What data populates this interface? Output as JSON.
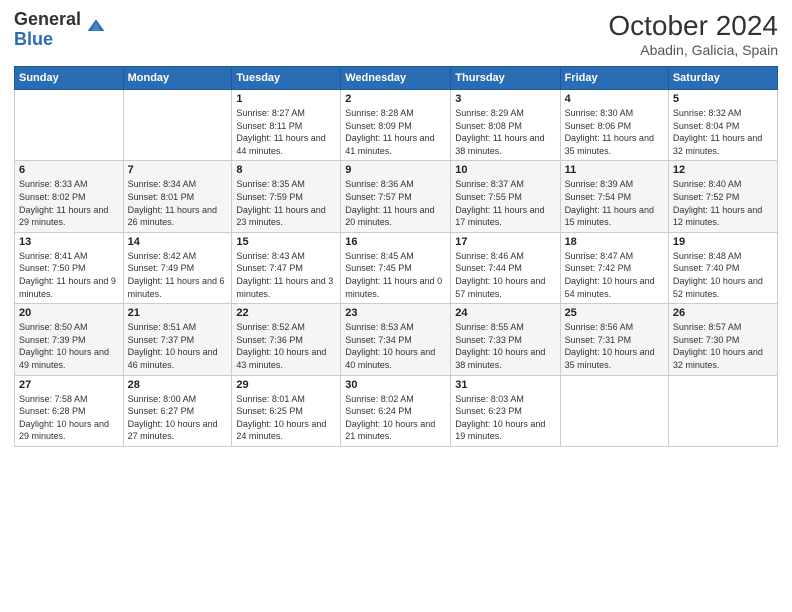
{
  "logo": {
    "general": "General",
    "blue": "Blue"
  },
  "title": "October 2024",
  "location": "Abadin, Galicia, Spain",
  "days_of_week": [
    "Sunday",
    "Monday",
    "Tuesday",
    "Wednesday",
    "Thursday",
    "Friday",
    "Saturday"
  ],
  "weeks": [
    [
      {
        "day": "",
        "sunrise": "",
        "sunset": "",
        "daylight": ""
      },
      {
        "day": "",
        "sunrise": "",
        "sunset": "",
        "daylight": ""
      },
      {
        "day": "1",
        "sunrise": "Sunrise: 8:27 AM",
        "sunset": "Sunset: 8:11 PM",
        "daylight": "Daylight: 11 hours and 44 minutes."
      },
      {
        "day": "2",
        "sunrise": "Sunrise: 8:28 AM",
        "sunset": "Sunset: 8:09 PM",
        "daylight": "Daylight: 11 hours and 41 minutes."
      },
      {
        "day": "3",
        "sunrise": "Sunrise: 8:29 AM",
        "sunset": "Sunset: 8:08 PM",
        "daylight": "Daylight: 11 hours and 38 minutes."
      },
      {
        "day": "4",
        "sunrise": "Sunrise: 8:30 AM",
        "sunset": "Sunset: 8:06 PM",
        "daylight": "Daylight: 11 hours and 35 minutes."
      },
      {
        "day": "5",
        "sunrise": "Sunrise: 8:32 AM",
        "sunset": "Sunset: 8:04 PM",
        "daylight": "Daylight: 11 hours and 32 minutes."
      }
    ],
    [
      {
        "day": "6",
        "sunrise": "Sunrise: 8:33 AM",
        "sunset": "Sunset: 8:02 PM",
        "daylight": "Daylight: 11 hours and 29 minutes."
      },
      {
        "day": "7",
        "sunrise": "Sunrise: 8:34 AM",
        "sunset": "Sunset: 8:01 PM",
        "daylight": "Daylight: 11 hours and 26 minutes."
      },
      {
        "day": "8",
        "sunrise": "Sunrise: 8:35 AM",
        "sunset": "Sunset: 7:59 PM",
        "daylight": "Daylight: 11 hours and 23 minutes."
      },
      {
        "day": "9",
        "sunrise": "Sunrise: 8:36 AM",
        "sunset": "Sunset: 7:57 PM",
        "daylight": "Daylight: 11 hours and 20 minutes."
      },
      {
        "day": "10",
        "sunrise": "Sunrise: 8:37 AM",
        "sunset": "Sunset: 7:55 PM",
        "daylight": "Daylight: 11 hours and 17 minutes."
      },
      {
        "day": "11",
        "sunrise": "Sunrise: 8:39 AM",
        "sunset": "Sunset: 7:54 PM",
        "daylight": "Daylight: 11 hours and 15 minutes."
      },
      {
        "day": "12",
        "sunrise": "Sunrise: 8:40 AM",
        "sunset": "Sunset: 7:52 PM",
        "daylight": "Daylight: 11 hours and 12 minutes."
      }
    ],
    [
      {
        "day": "13",
        "sunrise": "Sunrise: 8:41 AM",
        "sunset": "Sunset: 7:50 PM",
        "daylight": "Daylight: 11 hours and 9 minutes."
      },
      {
        "day": "14",
        "sunrise": "Sunrise: 8:42 AM",
        "sunset": "Sunset: 7:49 PM",
        "daylight": "Daylight: 11 hours and 6 minutes."
      },
      {
        "day": "15",
        "sunrise": "Sunrise: 8:43 AM",
        "sunset": "Sunset: 7:47 PM",
        "daylight": "Daylight: 11 hours and 3 minutes."
      },
      {
        "day": "16",
        "sunrise": "Sunrise: 8:45 AM",
        "sunset": "Sunset: 7:45 PM",
        "daylight": "Daylight: 11 hours and 0 minutes."
      },
      {
        "day": "17",
        "sunrise": "Sunrise: 8:46 AM",
        "sunset": "Sunset: 7:44 PM",
        "daylight": "Daylight: 10 hours and 57 minutes."
      },
      {
        "day": "18",
        "sunrise": "Sunrise: 8:47 AM",
        "sunset": "Sunset: 7:42 PM",
        "daylight": "Daylight: 10 hours and 54 minutes."
      },
      {
        "day": "19",
        "sunrise": "Sunrise: 8:48 AM",
        "sunset": "Sunset: 7:40 PM",
        "daylight": "Daylight: 10 hours and 52 minutes."
      }
    ],
    [
      {
        "day": "20",
        "sunrise": "Sunrise: 8:50 AM",
        "sunset": "Sunset: 7:39 PM",
        "daylight": "Daylight: 10 hours and 49 minutes."
      },
      {
        "day": "21",
        "sunrise": "Sunrise: 8:51 AM",
        "sunset": "Sunset: 7:37 PM",
        "daylight": "Daylight: 10 hours and 46 minutes."
      },
      {
        "day": "22",
        "sunrise": "Sunrise: 8:52 AM",
        "sunset": "Sunset: 7:36 PM",
        "daylight": "Daylight: 10 hours and 43 minutes."
      },
      {
        "day": "23",
        "sunrise": "Sunrise: 8:53 AM",
        "sunset": "Sunset: 7:34 PM",
        "daylight": "Daylight: 10 hours and 40 minutes."
      },
      {
        "day": "24",
        "sunrise": "Sunrise: 8:55 AM",
        "sunset": "Sunset: 7:33 PM",
        "daylight": "Daylight: 10 hours and 38 minutes."
      },
      {
        "day": "25",
        "sunrise": "Sunrise: 8:56 AM",
        "sunset": "Sunset: 7:31 PM",
        "daylight": "Daylight: 10 hours and 35 minutes."
      },
      {
        "day": "26",
        "sunrise": "Sunrise: 8:57 AM",
        "sunset": "Sunset: 7:30 PM",
        "daylight": "Daylight: 10 hours and 32 minutes."
      }
    ],
    [
      {
        "day": "27",
        "sunrise": "Sunrise: 7:58 AM",
        "sunset": "Sunset: 6:28 PM",
        "daylight": "Daylight: 10 hours and 29 minutes."
      },
      {
        "day": "28",
        "sunrise": "Sunrise: 8:00 AM",
        "sunset": "Sunset: 6:27 PM",
        "daylight": "Daylight: 10 hours and 27 minutes."
      },
      {
        "day": "29",
        "sunrise": "Sunrise: 8:01 AM",
        "sunset": "Sunset: 6:25 PM",
        "daylight": "Daylight: 10 hours and 24 minutes."
      },
      {
        "day": "30",
        "sunrise": "Sunrise: 8:02 AM",
        "sunset": "Sunset: 6:24 PM",
        "daylight": "Daylight: 10 hours and 21 minutes."
      },
      {
        "day": "31",
        "sunrise": "Sunrise: 8:03 AM",
        "sunset": "Sunset: 6:23 PM",
        "daylight": "Daylight: 10 hours and 19 minutes."
      },
      {
        "day": "",
        "sunrise": "",
        "sunset": "",
        "daylight": ""
      },
      {
        "day": "",
        "sunrise": "",
        "sunset": "",
        "daylight": ""
      }
    ]
  ]
}
